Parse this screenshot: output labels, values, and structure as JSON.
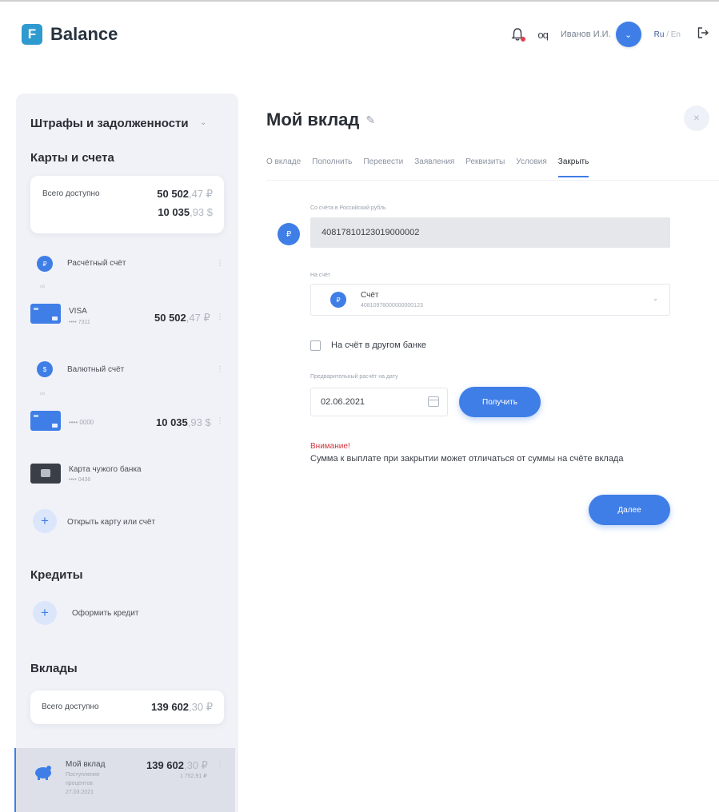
{
  "app": {
    "logo_letter": "F",
    "name": "Balance"
  },
  "header": {
    "link_icon_text": "oq",
    "user_name": "Иванов И.И.",
    "lang_ru": "Ru",
    "lang_sep": " / ",
    "lang_en": "En"
  },
  "sidebar": {
    "fines_title": "Штрафы и задолженности",
    "cards_title": "Карты и счета",
    "cards_total": {
      "label": "Всего доступно",
      "rub_main": "50 502",
      "rub_cents": ",47 ₽",
      "usd_main": "10 035",
      "usd_cents": ",93 $"
    },
    "settlement_account": {
      "label": "Расчётный счёт",
      "icon": "ruble-icon"
    },
    "visa_card": {
      "title": "VISA",
      "number": "•••• 7311",
      "amount_main": "50 502",
      "amount_cents": ",47 ₽"
    },
    "currency_account": {
      "label": "Валютный счёт",
      "icon": "dollar-icon"
    },
    "usd_card": {
      "number": "•••• 0000",
      "amount_main": "10 035",
      "amount_cents": ",93 $"
    },
    "foreign_card": {
      "title": "Карта чужого банка",
      "number": "•••• 0436"
    },
    "open_card": "Открыть карту или счёт",
    "credits_title": "Кредиты",
    "get_credit": "Оформить кредит",
    "deposits_title": "Вклады",
    "deposits_total": {
      "label": "Всего доступно",
      "amount_main": "139 602",
      "amount_cents": ",30 ₽"
    },
    "my_deposit": {
      "title": "Мой вклад",
      "line1": "Поступление",
      "line2": "процентов",
      "date": "27.03.2021",
      "amount_main": "139 602",
      "amount_cents": ",30 ₽",
      "sub_amount": "1 752,91 ₽"
    }
  },
  "main": {
    "title": "Мой вклад",
    "tabs": [
      "О вкладе",
      "Пополнить",
      "Перевести",
      "Заявления",
      "Реквизиты",
      "Условия",
      "Закрыть"
    ],
    "active_tab": "Закрыть",
    "from_label": "Со счёта в Российский рубль",
    "from_account": "40817810123019000002",
    "to_label": "На счёт",
    "to_title": "Счёт",
    "to_number": "40810978000000000123",
    "other_bank_label": "На счёт в другом банке",
    "date_label": "Предварительный расчёт на дату",
    "date_value": "02.06.2021",
    "get_button": "Получить",
    "warning_title": "Внимание!",
    "warning_text": "Сумма к выплате при закрытии может отличаться от суммы на счёте вклада",
    "next_button": "Далее"
  },
  "colors": {
    "accent": "#3f7ee7",
    "warning": "#d0343d",
    "sidebar_bg": "#f1f2f7"
  }
}
